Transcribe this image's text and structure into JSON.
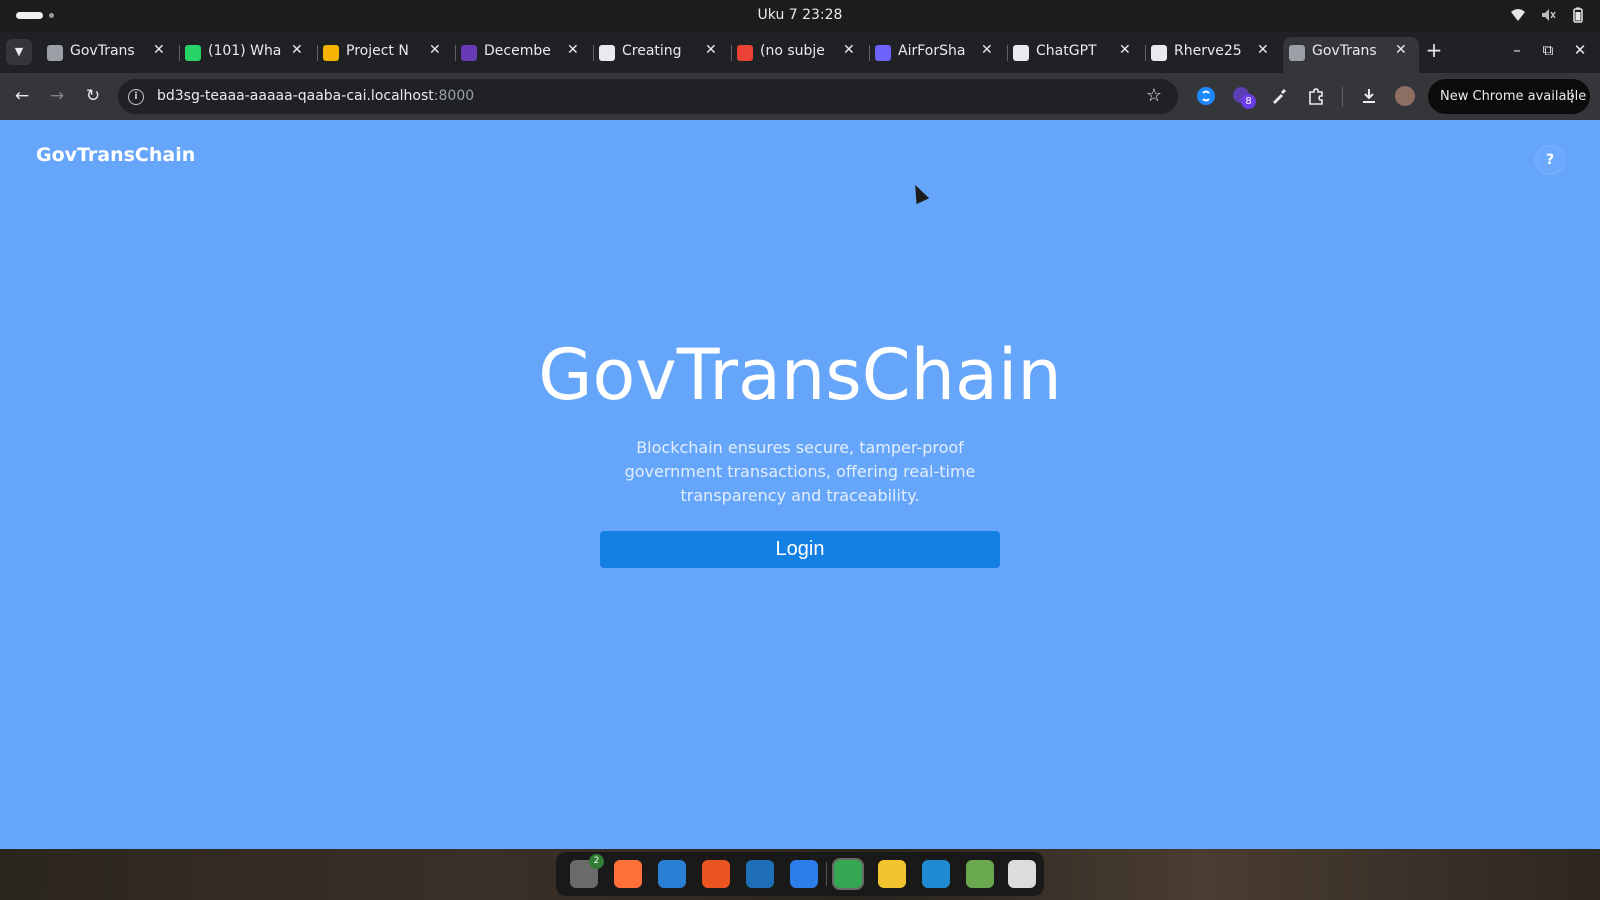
{
  "system_bar": {
    "clock": "Uku 7  23:28",
    "tray_icons": [
      "wifi-icon",
      "volume-muted-icon",
      "battery-icon"
    ]
  },
  "browser": {
    "tabs": [
      {
        "title": "GovTrans",
        "favicon": "globe-icon",
        "color": "#9aa0a6",
        "active": false
      },
      {
        "title": "(101) Wha",
        "favicon": "whatsapp-icon",
        "color": "#25d366",
        "active": false
      },
      {
        "title": "Project N",
        "favicon": "slides-icon",
        "color": "#f4b400",
        "active": false
      },
      {
        "title": "Decembe",
        "favicon": "forms-icon",
        "color": "#673ab7",
        "active": false
      },
      {
        "title": "Creating",
        "favicon": "page-icon",
        "color": "#e8eaed",
        "active": false
      },
      {
        "title": "(no subje",
        "favicon": "gmail-icon",
        "color": "#ea4335",
        "active": false
      },
      {
        "title": "AirForSha",
        "favicon": "airforshare-icon",
        "color": "#6c63ff",
        "active": false
      },
      {
        "title": "ChatGPT",
        "favicon": "chatgpt-icon",
        "color": "#e8eaed",
        "active": false
      },
      {
        "title": "Rherve25",
        "favicon": "github-icon",
        "color": "#e8eaed",
        "active": false
      },
      {
        "title": "GovTrans",
        "favicon": "globe-icon",
        "color": "#9aa0a6",
        "active": true
      }
    ],
    "address": {
      "host": "bd3sg-teaaa-aaaaa-qaaba-cai.localhost",
      "port": ":8000"
    },
    "extension_badge": "8",
    "update_button": "New Chrome available"
  },
  "page": {
    "brand": "GovTransChain",
    "help_label": "?",
    "hero_title": "GovTransChain",
    "hero_subtitle": "Blockchain ensures secure, tamper-proof government transactions, offering real-time transparency and traceability.",
    "login_label": "Login",
    "background_color": "#66a6fa",
    "button_color": "#1580e4"
  },
  "dock": {
    "items": [
      {
        "name": "files-icon",
        "color": "#6b6b6b",
        "badge": "2"
      },
      {
        "name": "firefox-icon",
        "color": "#ff7139"
      },
      {
        "name": "thunderbird-icon",
        "color": "#2a7fd4"
      },
      {
        "name": "app-center-icon",
        "color": "#e95420"
      },
      {
        "name": "writer-icon",
        "color": "#1e6fb8"
      },
      {
        "name": "help-icon",
        "color": "#2b7de9"
      },
      {
        "name": "chrome-icon",
        "color": "#34a853",
        "active": true
      },
      {
        "name": "text-editor-icon",
        "color": "#f4c430"
      },
      {
        "name": "vscode-icon",
        "color": "#1f8ad2"
      },
      {
        "name": "trash-icon",
        "color": "#6aa84f"
      },
      {
        "name": "show-apps-icon",
        "color": "#dcdcdc"
      }
    ]
  }
}
